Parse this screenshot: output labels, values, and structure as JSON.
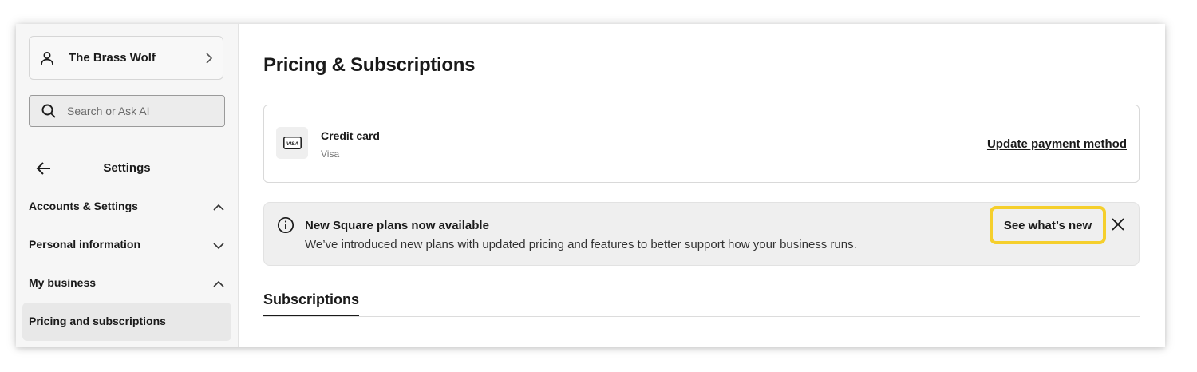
{
  "sidebar": {
    "account_name": "The Brass Wolf",
    "search_placeholder": "Search or Ask AI",
    "settings_title": "Settings",
    "nav": [
      {
        "label": "Accounts & Settings",
        "state": "expanded"
      },
      {
        "label": "Personal information",
        "state": "collapsed"
      },
      {
        "label": "My business",
        "state": "expanded"
      }
    ],
    "active_item": "Pricing and subscriptions"
  },
  "main": {
    "page_title": "Pricing & Subscriptions",
    "payment": {
      "title": "Credit card",
      "subtitle": "Visa",
      "card_brand": "VISA",
      "update_link": "Update payment method"
    },
    "banner": {
      "title": "New Square plans now available",
      "text": "We’ve introduced new plans with updated pricing and features to better support how your business runs.",
      "cta": "See what’s new"
    },
    "tab": "Subscriptions"
  },
  "colors": {
    "highlight": "#f5cf2c",
    "sidebar_bg": "#f6f6f6",
    "banner_bg": "#efefef",
    "text": "#1a1a1a"
  },
  "icons": [
    "person-icon",
    "chevron-right-icon",
    "search-icon",
    "arrow-left-icon",
    "chevron-up-icon",
    "chevron-down-icon",
    "visa-card-icon",
    "info-icon",
    "close-icon"
  ]
}
